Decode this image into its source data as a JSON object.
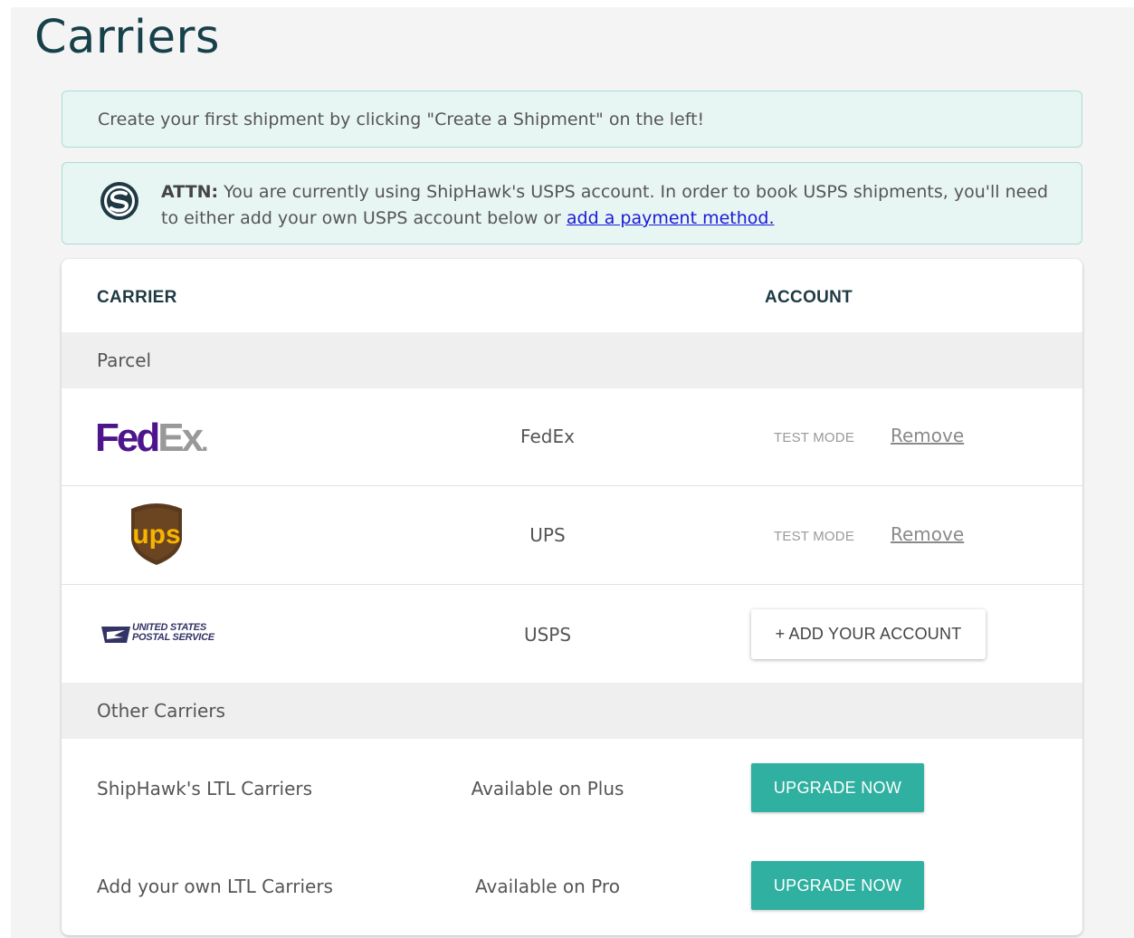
{
  "page": {
    "title": "Carriers"
  },
  "notices": {
    "first_shipment": "Create your first shipment by clicking \"Create a Shipment\" on the left!",
    "attn": {
      "label": "ATTN:",
      "text": " You are currently using ShipHawk's USPS account. In order to book USPS shipments, you'll need to either add your own USPS account below or ",
      "link": "add a payment method."
    }
  },
  "table": {
    "headers": {
      "carrier": "CARRIER",
      "account": "ACCOUNT"
    },
    "sections": {
      "parcel": "Parcel",
      "other": "Other Carriers"
    },
    "parcel_rows": [
      {
        "logo": "fedex-logo",
        "name": "FedEx",
        "status": "TEST MODE",
        "action": "Remove"
      },
      {
        "logo": "ups-logo",
        "name": "UPS",
        "status": "TEST MODE",
        "action": "Remove"
      },
      {
        "logo": "usps-logo",
        "name": "USPS",
        "action": "+ ADD YOUR ACCOUNT"
      }
    ],
    "other_rows": [
      {
        "name": "ShipHawk's LTL Carriers",
        "availability": "Available on Plus",
        "action": "UPGRADE NOW"
      },
      {
        "name": "Add your own LTL Carriers",
        "availability": "Available on Pro",
        "action": "UPGRADE NOW"
      }
    ]
  },
  "logos": {
    "fedex": {
      "fed": "Fed",
      "ex": "Ex",
      "dot": "."
    },
    "ups": {
      "text": "ups"
    },
    "usps": {
      "line1": "UNITED STATES",
      "line2": "POSTAL SERVICE"
    }
  },
  "colors": {
    "title": "#17414a",
    "notice_bg": "#e8f6f3",
    "notice_border": "#a9ddd2",
    "upgrade_button": "#2fb0a0",
    "link": "#1a1ad8",
    "fedex_purple": "#4d148c",
    "fedex_gray": "#999999",
    "ups_brown": "#5a3a1e",
    "ups_gold": "#f7b500",
    "usps_blue": "#333366"
  }
}
